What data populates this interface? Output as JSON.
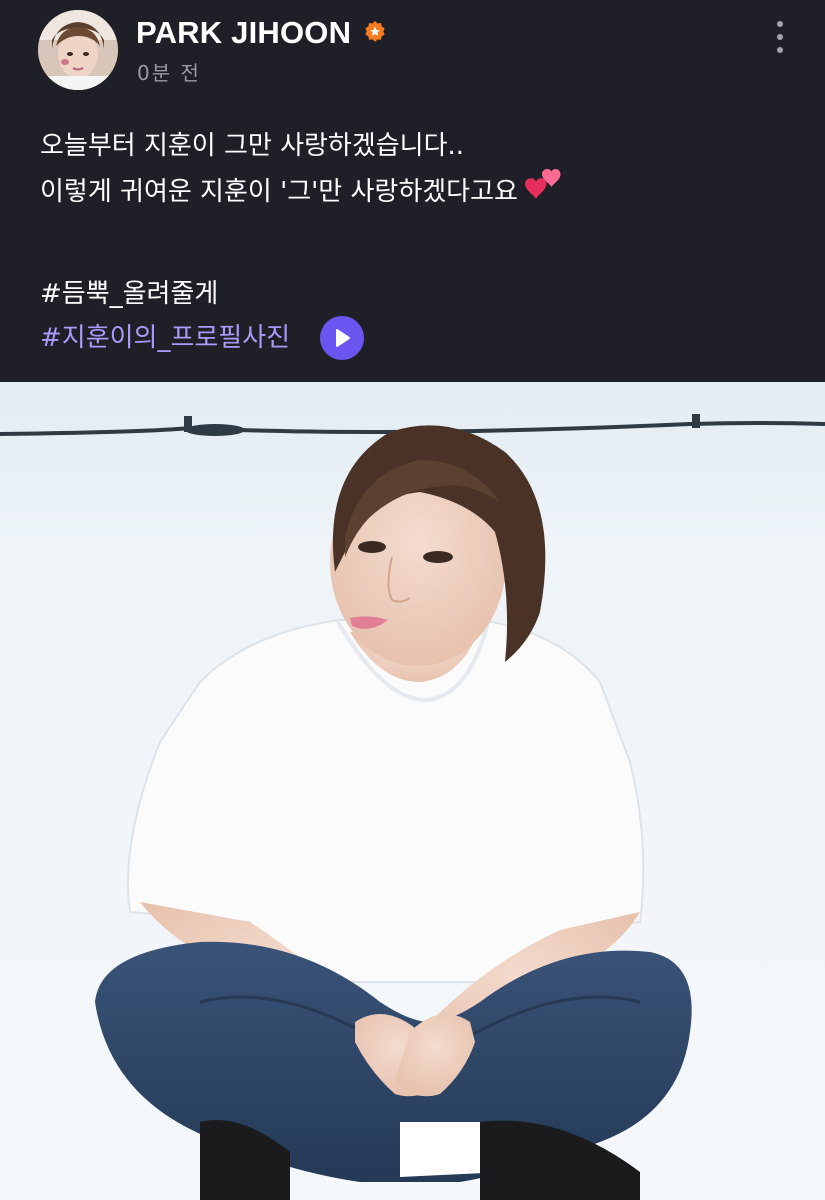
{
  "post": {
    "author": {
      "name": "PARK JIHOON",
      "avatar_icon": "profile-photo",
      "verified_icon": "verified-badge-icon",
      "verified_color": "#f57c1f"
    },
    "timestamp": "0분 전",
    "menu_icon": "more-vertical-icon",
    "text_lines": [
      "오늘부터 지훈이 그만 사랑하겠습니다..",
      "이렇게 귀여운 지훈이 '그'만 사랑하겠다고요"
    ],
    "emoji": "two-hearts-icon",
    "hashtags": {
      "plain": "#듬뿍_올려줄게",
      "link": "#지훈이의_프로필사진",
      "link_color": "#a79bfa"
    },
    "play_icon": "play-icon",
    "play_color": "#6a55f0"
  },
  "photo": {
    "subject": "photo-of-person-in-white-tshirt-and-jeans-sitting-cross-legged"
  }
}
